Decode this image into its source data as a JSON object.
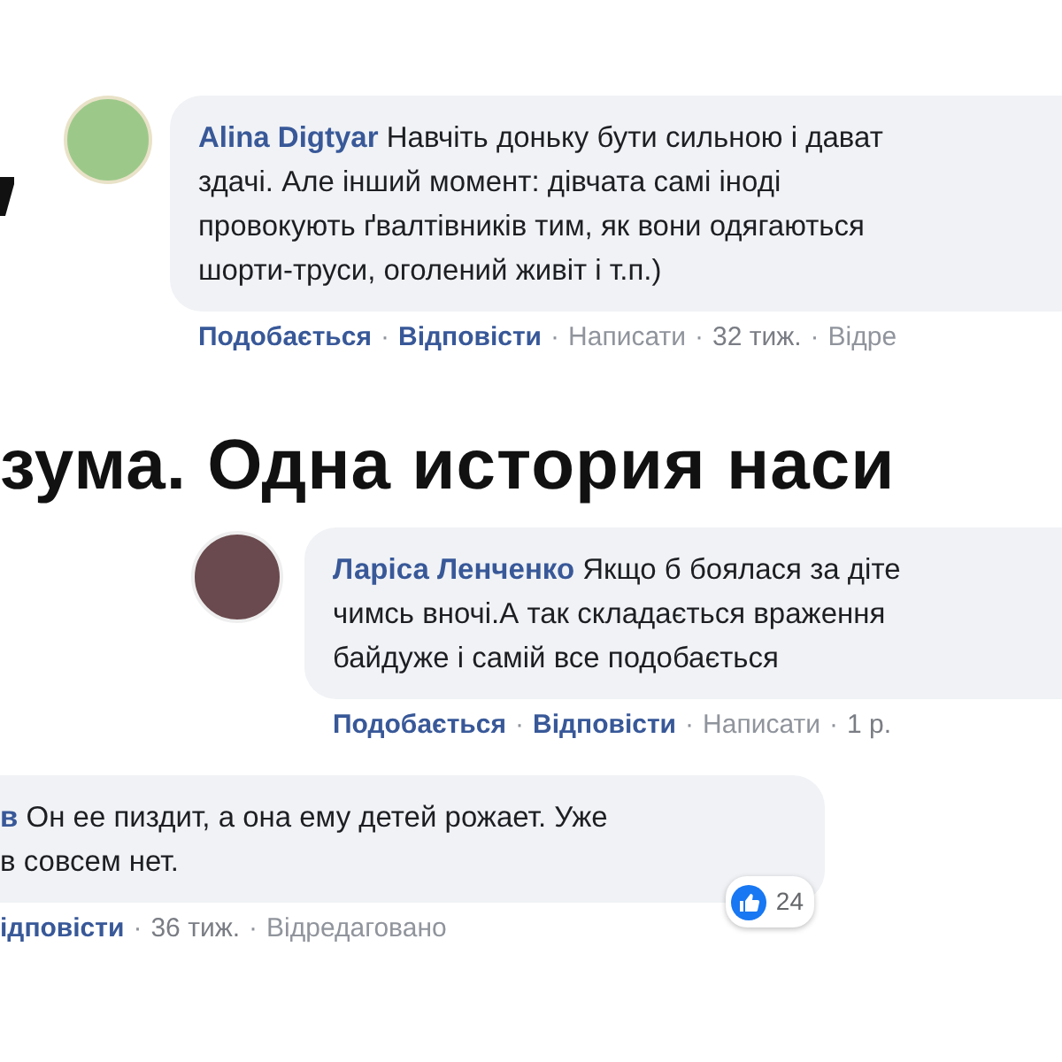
{
  "headline": "зума. Одна история наси",
  "comments": [
    {
      "author": "Alina Digtyar",
      "lines": [
        "Навчіть доньку бути сильною і дават",
        "здачі. Але інший момент: дівчата самі іноді",
        "провокують ґвалтівників тим, як вони одягаються",
        "шорти-труси, оголений живіт і т.п.)"
      ],
      "actions": [
        {
          "text": "Подобається",
          "kind": "link"
        },
        {
          "text": "·",
          "kind": "separator"
        },
        {
          "text": "Відповісти",
          "kind": "link"
        },
        {
          "text": "·",
          "kind": "separator"
        },
        {
          "text": "Написати",
          "kind": "meta"
        },
        {
          "text": "·",
          "kind": "separator"
        },
        {
          "text": "32 тиж.",
          "kind": "time"
        },
        {
          "text": "·",
          "kind": "separator"
        },
        {
          "text": "Відре",
          "kind": "meta"
        }
      ]
    },
    {
      "author": "Ларіса Ленченко",
      "lines": [
        "Якщо б боялася за діте",
        "чимсь вночі.А так складається враження",
        "байдуже і самій все подобається"
      ],
      "actions": [
        {
          "text": "Подобається",
          "kind": "link"
        },
        {
          "text": "·",
          "kind": "separator"
        },
        {
          "text": "Відповісти",
          "kind": "link"
        },
        {
          "text": "·",
          "kind": "separator"
        },
        {
          "text": "Написати",
          "kind": "meta"
        },
        {
          "text": "·",
          "kind": "separator"
        },
        {
          "text": "1 р.",
          "kind": "time"
        }
      ]
    },
    {
      "author": "в",
      "lines": [
        "Он ее пиздит, а она ему детей рожает. Уже",
        "в совсем нет."
      ],
      "actions": [
        {
          "text": "ідповісти",
          "kind": "link"
        },
        {
          "text": "·",
          "kind": "separator"
        },
        {
          "text": "36 тиж.",
          "kind": "time"
        },
        {
          "text": "·",
          "kind": "separator"
        },
        {
          "text": "Відредаговано",
          "kind": "meta"
        }
      ],
      "likes": "24"
    }
  ]
}
